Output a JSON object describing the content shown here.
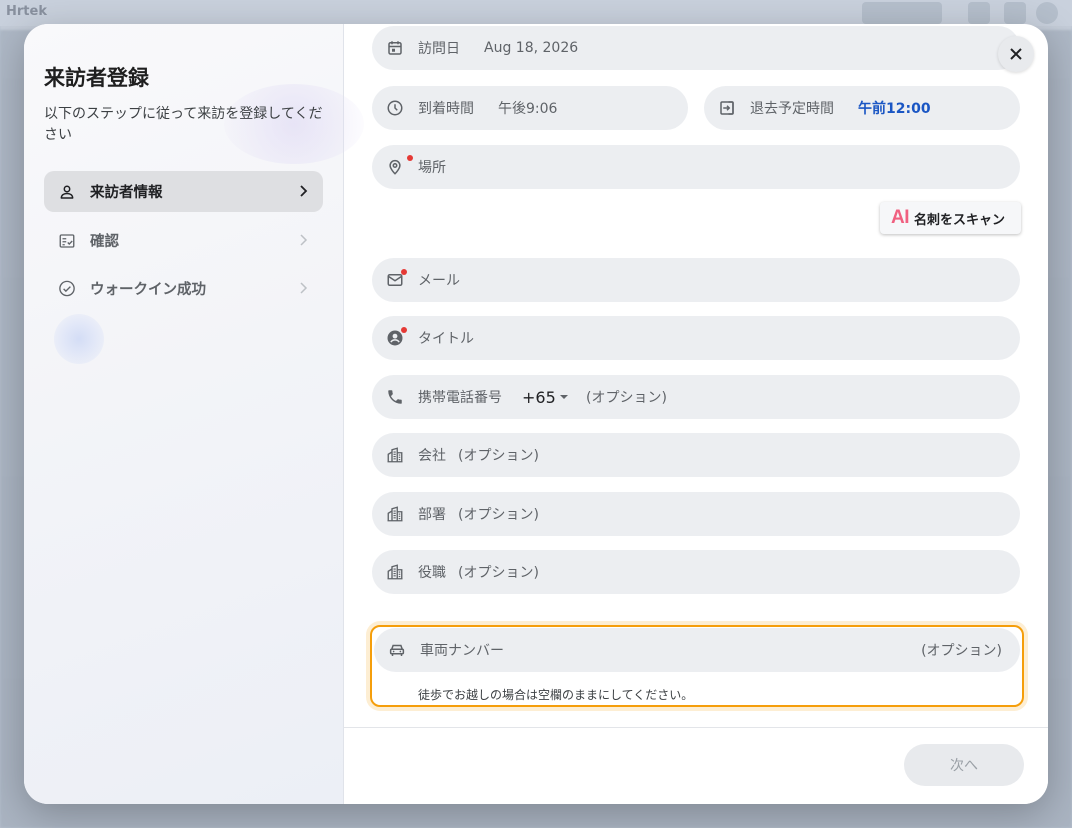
{
  "background": {
    "app_name": "Hrtek"
  },
  "sidebar": {
    "title": "来訪者登録",
    "subtitle": "以下のステップに従って来訪を登録してください",
    "steps": [
      {
        "label": "来訪者情報",
        "icon": "person-icon",
        "active": true
      },
      {
        "label": "確認",
        "icon": "checklist-icon",
        "active": false
      },
      {
        "label": "ウォークイン成功",
        "icon": "check-circle-icon",
        "active": false
      }
    ]
  },
  "form": {
    "visit_date": {
      "label": "訪問日",
      "value": "Aug 18, 2026"
    },
    "arrival_time": {
      "label": "到着時間",
      "value": "午後9:06"
    },
    "departure_time": {
      "label": "退去予定時間",
      "value": "午前12:00"
    },
    "location": {
      "label": "場所"
    },
    "scan_button": {
      "ai": "AI",
      "label": "名刺をスキャン"
    },
    "email": {
      "label": "メール"
    },
    "title": {
      "label": "タイトル"
    },
    "mobile": {
      "label": "携帯電話番号",
      "country_code": "+65",
      "optional": "(オプション)"
    },
    "company": {
      "label": "会社",
      "optional": "(オプション)"
    },
    "department": {
      "label": "部署",
      "optional": "(オプション)"
    },
    "position": {
      "label": "役職",
      "optional": "(オプション)"
    },
    "vehicle": {
      "label": "車両ナンバー",
      "optional": "(オプション)",
      "helper": "徒歩でお越しの場合は空欄のままにしてください。"
    }
  },
  "footer": {
    "next_label": "次へ"
  },
  "colors": {
    "accent": "#1a56c4",
    "required": "#e53935",
    "highlight": "#f59e0b",
    "ai": "#f06080"
  }
}
